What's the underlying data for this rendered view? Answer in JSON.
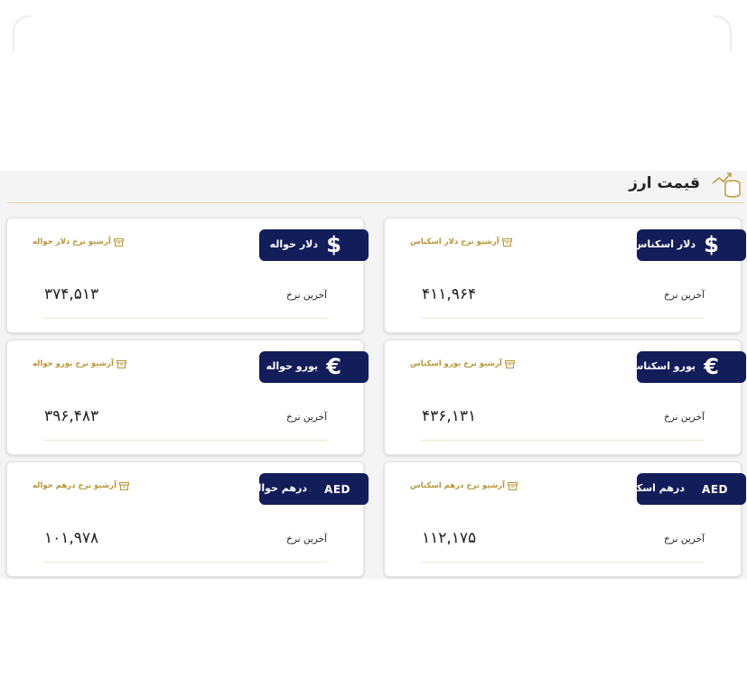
{
  "header": {
    "title": "قیمت ارز"
  },
  "common": {
    "last_rate_label": "آخرین نرخ"
  },
  "cards": [
    {
      "name": "dollar-cash",
      "symbol": "$",
      "label": "دلار اسکناس",
      "archive": "آرشیو نرخ دلار اسکناس",
      "price": "۴۱۱,۹۶۴",
      "icon": "dollar-icon"
    },
    {
      "name": "dollar-transfer",
      "symbol": "$",
      "label": "دلار حواله",
      "archive": "آرشیو نرخ دلار حواله",
      "price": "۳۷۴,۵۱۳",
      "icon": "dollar-icon"
    },
    {
      "name": "euro-cash",
      "symbol": "€",
      "label": "یورو اسکناس",
      "archive": "آرشیو نرخ یورو اسکناس",
      "price": "۴۳۶,۱۳۱",
      "icon": "euro-icon"
    },
    {
      "name": "euro-transfer",
      "symbol": "€",
      "label": "یورو حواله",
      "archive": "آرشیو نرخ یورو حواله",
      "price": "۳۹۶,۴۸۳",
      "icon": "euro-icon"
    },
    {
      "name": "dirham-cash",
      "symbol": "AED",
      "label": "درهم اسکناس",
      "archive": "آرشیو نرخ درهم اسکناس",
      "price": "۱۱۲,۱۷۵",
      "icon": "aed-icon"
    },
    {
      "name": "dirham-transfer",
      "symbol": "AED",
      "label": "درهم حواله",
      "archive": "آرشیو نرخ درهم حواله",
      "price": "۱۰۱,۹۷۸",
      "icon": "aed-icon"
    }
  ],
  "colors": {
    "badge": "#121d5a",
    "accent_gold": "#b89435",
    "panel_bg": "#f4f4f4"
  }
}
